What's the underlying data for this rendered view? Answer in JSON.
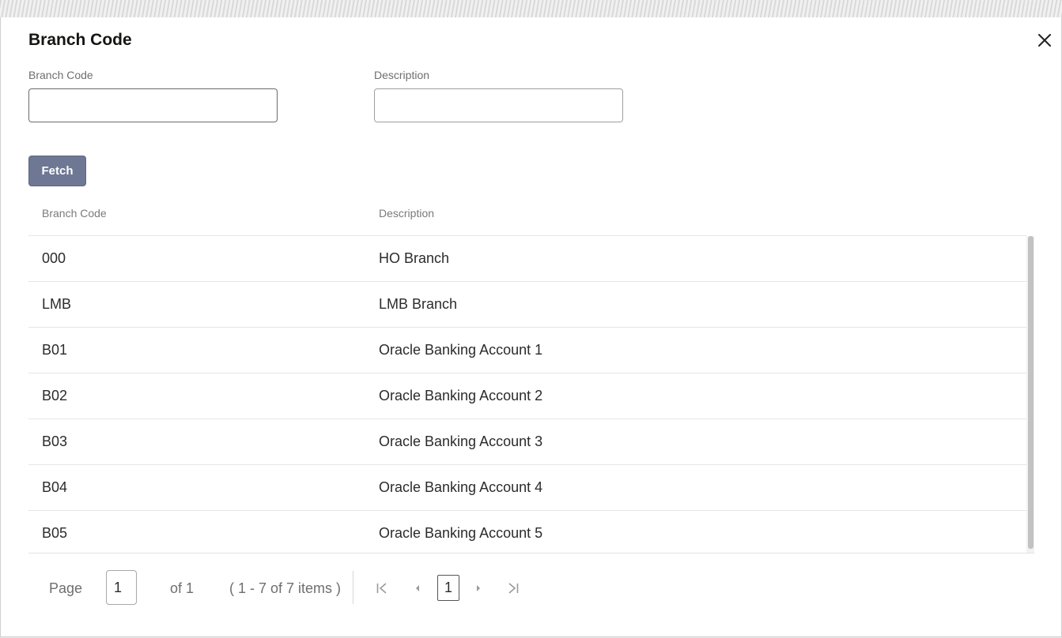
{
  "dialog": {
    "title": "Branch Code",
    "close_icon": "close-icon"
  },
  "search": {
    "branch_code_label": "Branch Code",
    "branch_code_value": "",
    "description_label": "Description",
    "description_value": "",
    "fetch_label": "Fetch"
  },
  "table": {
    "columns": [
      "Branch Code",
      "Description"
    ],
    "rows": [
      {
        "code": "000",
        "description": "HO Branch"
      },
      {
        "code": "LMB",
        "description": "LMB Branch"
      },
      {
        "code": "B01",
        "description": "Oracle Banking Account 1"
      },
      {
        "code": "B02",
        "description": "Oracle Banking Account 2"
      },
      {
        "code": "B03",
        "description": "Oracle Banking Account 3"
      },
      {
        "code": "B04",
        "description": "Oracle Banking Account 4"
      },
      {
        "code": "B05",
        "description": "Oracle Banking Account 5"
      }
    ]
  },
  "pagination": {
    "page_label": "Page",
    "page_value": "1",
    "of_label": "of 1",
    "items_summary": "( 1 - 7 of 7 items )",
    "current_page": "1",
    "icons": [
      "first-page-icon",
      "prev-page-icon",
      "next-page-icon",
      "last-page-icon"
    ]
  },
  "colors": {
    "fetch_button": "#6e7793",
    "text": "#2b2b2b",
    "muted": "#6e6e6e"
  }
}
